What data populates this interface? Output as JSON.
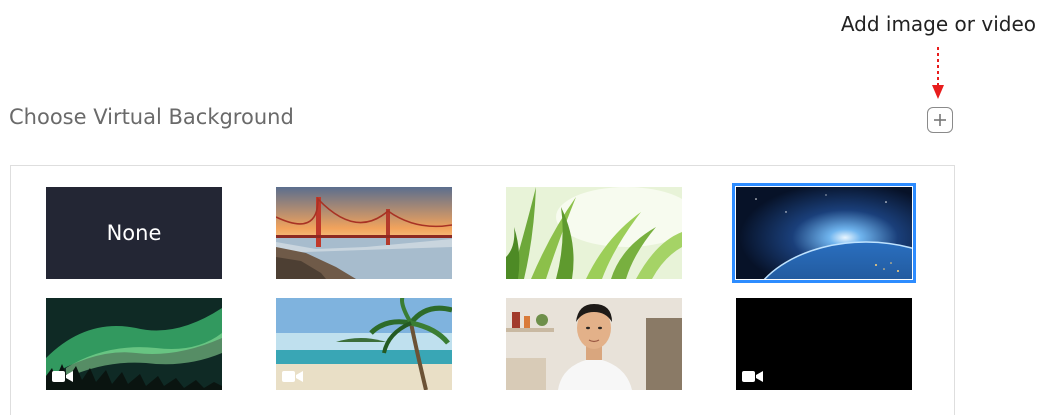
{
  "annotation": {
    "text": "Add image or video",
    "arrow_color": "#e81d1d"
  },
  "section": {
    "title": "Choose Virtual Background"
  },
  "add_button": {
    "icon": "plus-icon"
  },
  "selection_color": "#2d8cff",
  "backgrounds": [
    {
      "name": "None",
      "type": "none",
      "selected": false
    },
    {
      "type": "image",
      "depicts": "golden-gate-bridge",
      "selected": false
    },
    {
      "type": "image",
      "depicts": "grass",
      "selected": false
    },
    {
      "type": "image",
      "depicts": "earth-from-space",
      "selected": true
    },
    {
      "type": "video",
      "depicts": "aurora",
      "icon": "video-camera-icon",
      "selected": false
    },
    {
      "type": "video",
      "depicts": "beach-palm",
      "icon": "video-camera-icon",
      "selected": false
    },
    {
      "type": "image",
      "depicts": "person-in-room",
      "selected": false
    },
    {
      "type": "video",
      "depicts": "black",
      "icon": "video-camera-icon",
      "selected": false
    }
  ]
}
